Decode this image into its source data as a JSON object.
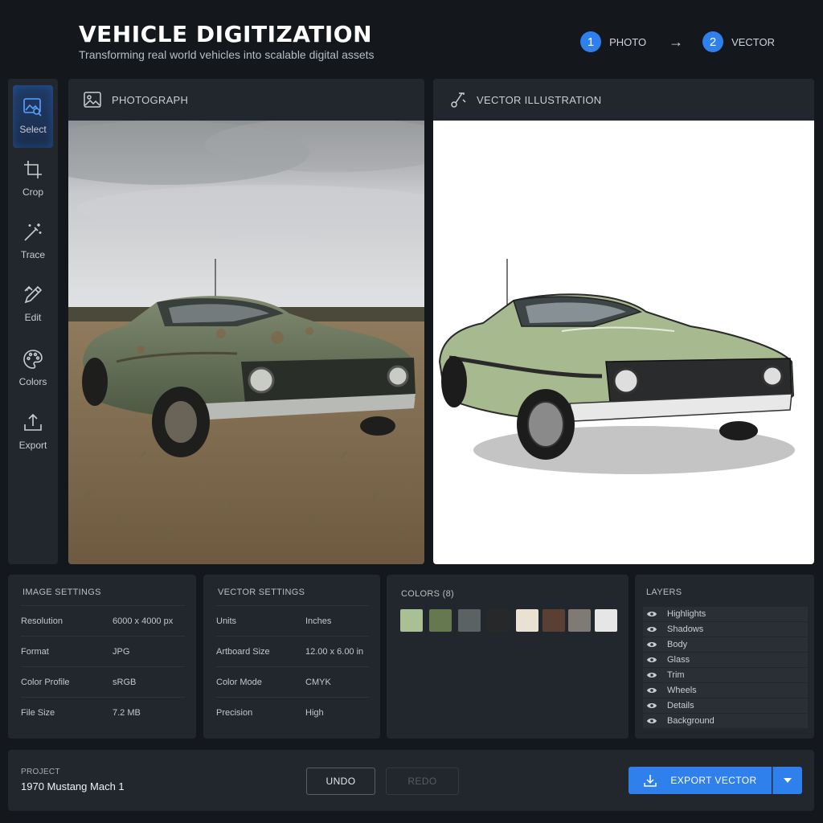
{
  "header": {
    "title": "VEHICLE DIGITIZATION",
    "subtitle": "Transforming real world vehicles into scalable digital assets",
    "steps": [
      {
        "number": "1",
        "label": "PHOTO"
      },
      {
        "number": "2",
        "label": "VECTOR"
      }
    ],
    "step_arrow": "→"
  },
  "sidebar": {
    "tools": [
      {
        "label": "Select",
        "icon": "image-search-icon",
        "active": true
      },
      {
        "label": "Crop",
        "icon": "crop-icon"
      },
      {
        "label": "Trace",
        "icon": "magic-wand-icon"
      },
      {
        "label": "Edit",
        "icon": "pen-ruler-icon"
      },
      {
        "label": "Colors",
        "icon": "palette-icon"
      },
      {
        "label": "Export",
        "icon": "upload-icon"
      }
    ]
  },
  "panels": {
    "photo": {
      "title": "PHOTOGRAPH",
      "icon": "image-icon"
    },
    "vector": {
      "title": "VECTOR ILLUSTRATION",
      "icon": "bezier-pen-icon"
    }
  },
  "image_settings": {
    "title": "IMAGE SETTINGS",
    "rows": [
      {
        "key": "Resolution",
        "value": "6000 x 4000 px"
      },
      {
        "key": "Format",
        "value": "JPG"
      },
      {
        "key": "Color Profile",
        "value": "sRGB"
      },
      {
        "key": "File Size",
        "value": "7.2 MB"
      }
    ]
  },
  "vector_settings": {
    "title": "VECTOR SETTINGS",
    "rows": [
      {
        "key": "Units",
        "value": "Inches"
      },
      {
        "key": "Artboard Size",
        "value": "12.00 x 6.00 in"
      },
      {
        "key": "Color Mode",
        "value": "CMYK"
      },
      {
        "key": "Precision",
        "value": "High"
      }
    ]
  },
  "colors": {
    "title": "COLORS (8)",
    "swatches": [
      "#a9bf94",
      "#66784f",
      "#5b6263",
      "#26282a",
      "#e9e1d2",
      "#5a4033",
      "#7f7a73",
      "#e6e6e6"
    ]
  },
  "layers": {
    "title": "LAYERS",
    "items": [
      "Highlights",
      "Shadows",
      "Body",
      "Glass",
      "Trim",
      "Wheels",
      "Details",
      "Background"
    ]
  },
  "footer": {
    "project_label": "PROJECT",
    "project_name": "1970 Mustang Mach 1",
    "undo": "UNDO",
    "redo": "REDO",
    "export": "EXPORT VECTOR"
  },
  "theme": {
    "accent": "#2f80ed",
    "panel": "#22262d",
    "background": "#14171c"
  }
}
